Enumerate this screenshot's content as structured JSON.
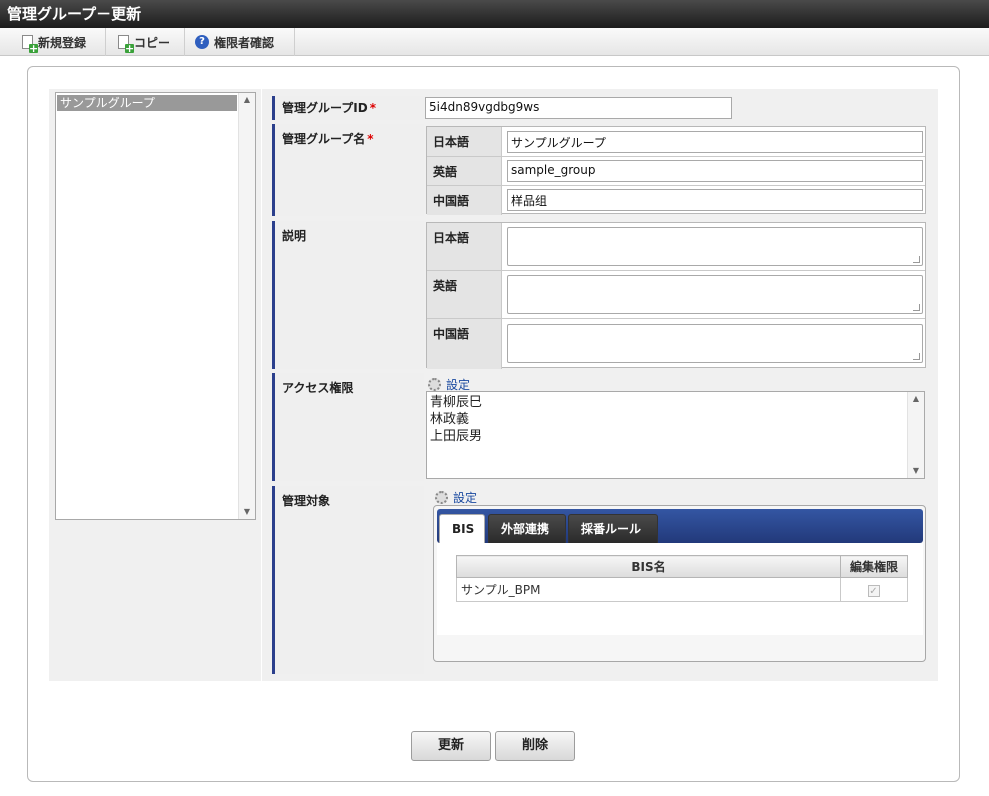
{
  "window": {
    "title": "管理グループ－更新"
  },
  "toolbar": {
    "new_label": "新規登録",
    "copy_label": "コピー",
    "perm_label": "権限者確認"
  },
  "group_list": {
    "items": [
      "サンプルグループ"
    ]
  },
  "form": {
    "id_label": "管理グループID",
    "id_value": "5i4dn89vgdbg9ws",
    "name_label": "管理グループ名",
    "required_mark": "*",
    "desc_label": "説明",
    "access_label": "アクセス権限",
    "target_label": "管理対象",
    "lang_ja": "日本語",
    "lang_en": "英語",
    "lang_zh": "中国語",
    "name_ja": "サンプルグループ",
    "name_en": "sample_group",
    "name_zh": "样品组",
    "settings_label": "設定",
    "access_users": [
      "青柳辰巳",
      "林政義",
      "上田辰男"
    ]
  },
  "tabs": [
    {
      "label": "BIS",
      "active": true
    },
    {
      "label": "外部連携",
      "active": false
    },
    {
      "label": "採番ルール",
      "active": false
    }
  ],
  "bis_table": {
    "headers": [
      "BIS名",
      "編集権限"
    ],
    "rows": [
      {
        "name": "サンプル_BPM",
        "edit": true
      }
    ]
  },
  "buttons": {
    "update": "更新",
    "delete": "削除"
  },
  "colors": {
    "accent": "#2b3f8c",
    "tabbar": "#2a4590",
    "required": "#dd0000",
    "link": "#1b4aa0"
  }
}
